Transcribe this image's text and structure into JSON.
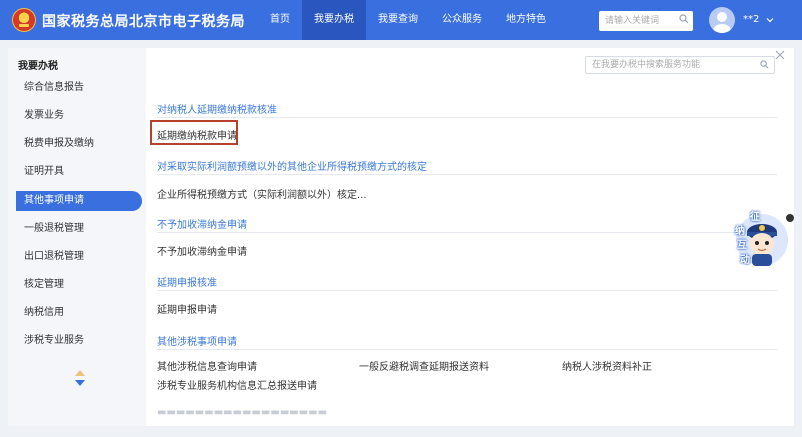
{
  "header": {
    "site_title": "国家税务总局北京市电子税务局",
    "nav": [
      "首页",
      "我要办税",
      "我要查询",
      "公众服务",
      "地方特色"
    ],
    "active_nav": 1,
    "search_placeholder": "请输入关键词",
    "user_name": "**2"
  },
  "sidebar": {
    "title": "我要办税",
    "items": [
      "综合信息报告",
      "发票业务",
      "税费申报及缴纳",
      "证明开具",
      "其他事项申请",
      "一般退税管理",
      "出口退税管理",
      "核定管理",
      "纳税信用",
      "涉税专业服务"
    ],
    "active_index": 4
  },
  "main": {
    "search_placeholder": "在我要办税中搜索服务功能",
    "sections": [
      {
        "title": "对纳税人延期缴纳税款核准",
        "links": [
          "延期缴纳税款申请"
        ]
      },
      {
        "title": "对采取实际利润额预缴以外的其他企业所得税预缴方式的核定",
        "links": [
          "企业所得税预缴方式（实际利润额以外）核定..."
        ]
      },
      {
        "title": "不予加收滞纳金申请",
        "links": [
          "不予加收滞纳金申请"
        ]
      },
      {
        "title": "延期申报核准",
        "links": [
          "延期申报申请"
        ]
      },
      {
        "title": "其他涉税事项申请",
        "links": [
          "其他涉税信息查询申请",
          "一般反避税调查延期报送资料",
          "纳税人涉税资料补正",
          "涉税专业服务机构信息汇总报送申请"
        ]
      }
    ]
  },
  "mascot": {
    "chars": [
      "征",
      "纳",
      "互",
      "动"
    ]
  },
  "colors": {
    "brand": "#3a6fe0",
    "link_title": "#3a78d8",
    "highlight": "#b8412c"
  }
}
